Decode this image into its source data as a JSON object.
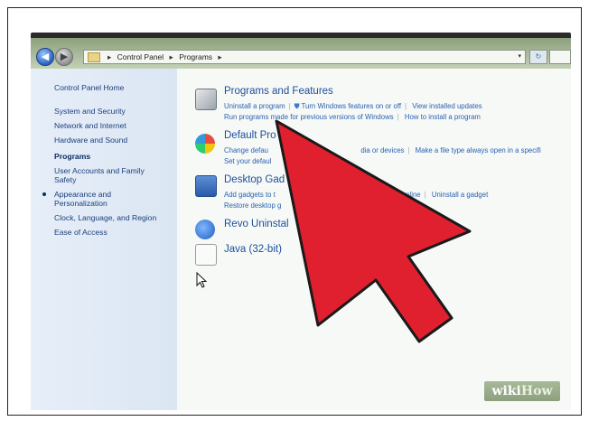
{
  "breadcrumb": {
    "segments": [
      "Control Panel",
      "Programs"
    ],
    "dropdown_glyph": "▾",
    "refresh_glyph": "↻"
  },
  "sidebar": {
    "items": [
      {
        "label": "Control Panel Home",
        "active": false
      },
      {
        "label": "System and Security",
        "active": false
      },
      {
        "label": "Network and Internet",
        "active": false
      },
      {
        "label": "Hardware and Sound",
        "active": false
      },
      {
        "label": "Programs",
        "active": true
      },
      {
        "label": "User Accounts and Family",
        "active": false
      },
      {
        "label": "Safety",
        "active": false
      },
      {
        "label": "Appearance and",
        "active": false
      },
      {
        "label": "Personalization",
        "active": false
      },
      {
        "label": "Clock, Language, and Region",
        "active": false
      },
      {
        "label": "Ease of Access",
        "active": false
      }
    ]
  },
  "categories": [
    {
      "title": "Programs and Features",
      "icon": "programs-features-icon",
      "links_row1": [
        "Uninstall a program",
        "Turn Windows features on or off",
        "View installed updates"
      ],
      "links_row2": [
        "Run programs made for previous versions of Windows",
        "How to install a program"
      ]
    },
    {
      "title": "Default Pro",
      "icon": "default-programs-icon",
      "links_row1": [
        "Change defau",
        "dia or devices",
        "Make a file type always open in a specifi"
      ],
      "links_row2": [
        "Set your defaul"
      ]
    },
    {
      "title": "Desktop Gad",
      "icon": "desktop-gadgets-icon",
      "links_row1": [
        "Add gadgets to t",
        "nline",
        "Uninstall a gadget"
      ],
      "links_row2": [
        "Restore desktop g"
      ]
    },
    {
      "title": "Revo Uninstal",
      "icon": "revo-uninstaller-icon",
      "links_row1": [],
      "links_row2": []
    },
    {
      "title": "Java (32-bit)",
      "icon": "java-icon",
      "links_row1": [],
      "links_row2": []
    }
  ],
  "watermark": {
    "wiki": "wiki",
    "how": "How"
  },
  "colors": {
    "arrow": "#e0202e",
    "link": "#2a62b0",
    "title": "#1c4f9c"
  }
}
